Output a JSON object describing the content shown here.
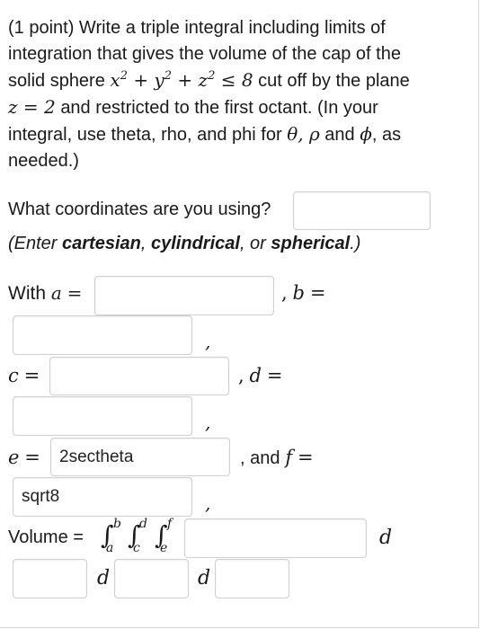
{
  "problem": {
    "line1": "(1 point) Write a triple integral including limits of",
    "line2": "integration that gives the volume of the cap of the",
    "line3_a": "solid sphere",
    "line3_b": "cut off by the plane",
    "line4_b": "and restricted to the first octant. (In your",
    "line5_a": "integral, use theta, rho, and phi for",
    "line5_b": "and",
    "line5_c": ", as",
    "line6": "needed.)"
  },
  "coords": {
    "question": "What coordinates are you using?",
    "hint_open": "(Enter ",
    "opt1": "cartesian",
    "sep1": ", ",
    "opt2": "cylindrical",
    "sep2": ", or ",
    "opt3": "spherical",
    "hint_close": ".)",
    "value": ""
  },
  "limits": {
    "with_label": "With",
    "a": "",
    "b": "",
    "c": "",
    "d": "",
    "e": "2sectheta",
    "and_label": ", and",
    "f": "sqrt8"
  },
  "volume": {
    "label": "Volume =",
    "integrand": "",
    "d1_var": "",
    "d2_var": "",
    "d3_var": ""
  }
}
